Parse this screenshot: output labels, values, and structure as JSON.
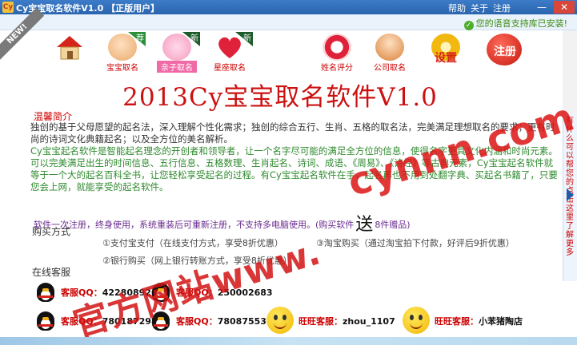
{
  "titlebar": {
    "title": "Cy宝宝取名软件V1.0 【正版用户】",
    "menu": [
      "帮助",
      "关于",
      "注册"
    ],
    "minimize": "—",
    "close": "✕"
  },
  "status": {
    "voice_text": "您的语音支持库已安装!",
    "ribbon": "NEW!"
  },
  "toolbar": [
    {
      "label": "",
      "icon": "home-icon"
    },
    {
      "label": "宝宝取名",
      "icon": "baby-icon",
      "tag": "荐"
    },
    {
      "label": "亲子取名",
      "icon": "family-icon",
      "tag": "新"
    },
    {
      "label": "星座取名",
      "icon": "heart-icon",
      "tag": "新"
    },
    {
      "label": "姓名评分",
      "icon": "rating-icon"
    },
    {
      "label": "公司取名",
      "icon": "company-icon"
    },
    {
      "label": "设置",
      "icon": "settings-icon"
    },
    {
      "label": "注册",
      "icon": "register-icon"
    }
  ],
  "heading": "2013Cy宝宝取名软件V1.0",
  "intro": {
    "title": "温馨简介",
    "p1": "独创的基于父母愿望的起名法，深入理解个性化需求；独创的综合五行、生肖、五格的取名法，完美满足理想取名的要求；更有时尚的诗词文化典籍起名；以及全方位的美名解析。",
    "p2": "Cy宝宝起名软件是智能起名理念的开创者和领导者，让一个名字尽可能的满足全方位的信息，使得名字更具文化内涵和时尚元素。可以完美满足出生的时间信息、五行信息、五格数理、生肖起名、诗词、成语、《周易》、《诗经》等古典元素，Cy宝宝起名软件就等于一个大的起名百科全书，让您轻松享受起名的过程。有Cy宝宝起名软件在手，起名再也不用到处翻字典、买起名书籍了，只要您会上网，就能享受的起名软件。"
  },
  "promo": {
    "before": "软件一次注册，终身使用，系统重装后可重新注册，不支持多电脑使用。(购买软件",
    "gift": "送",
    "after": "8件赠品)"
  },
  "purchase": {
    "title": "购买方式",
    "opt1": "①支付宝支付（在线支付方式，享受8折优惠）",
    "opt2": "②银行购买（网上银行转账方式，享受8折优惠）",
    "opt3": "③淘宝购买（通过淘宝拍下付款，好评后9折优惠）"
  },
  "online": {
    "title": "在线客服",
    "contacts": [
      {
        "label": "客服QQ：",
        "value": "422808926"
      },
      {
        "label": "客服QQ：",
        "value": "250002683"
      },
      {
        "label": "客服QQ：",
        "value": "780187298"
      },
      {
        "label": "客服QQ：",
        "value": "780875537"
      },
      {
        "label": "旺旺客服：",
        "value": "zhou_1107"
      },
      {
        "label": "旺旺客服：",
        "value": "小苯猪陶店"
      }
    ]
  },
  "side_ad": {
    "text": "有什么可以帮您的点击这里了解更多"
  },
  "watermark": {
    "big": "官方网站www.",
    "url": "cynnn.com"
  },
  "colors": {
    "accent_red": "#cc1111",
    "titlebar_blue": "#2a64ad",
    "intro_green": "#2e8a2e"
  }
}
